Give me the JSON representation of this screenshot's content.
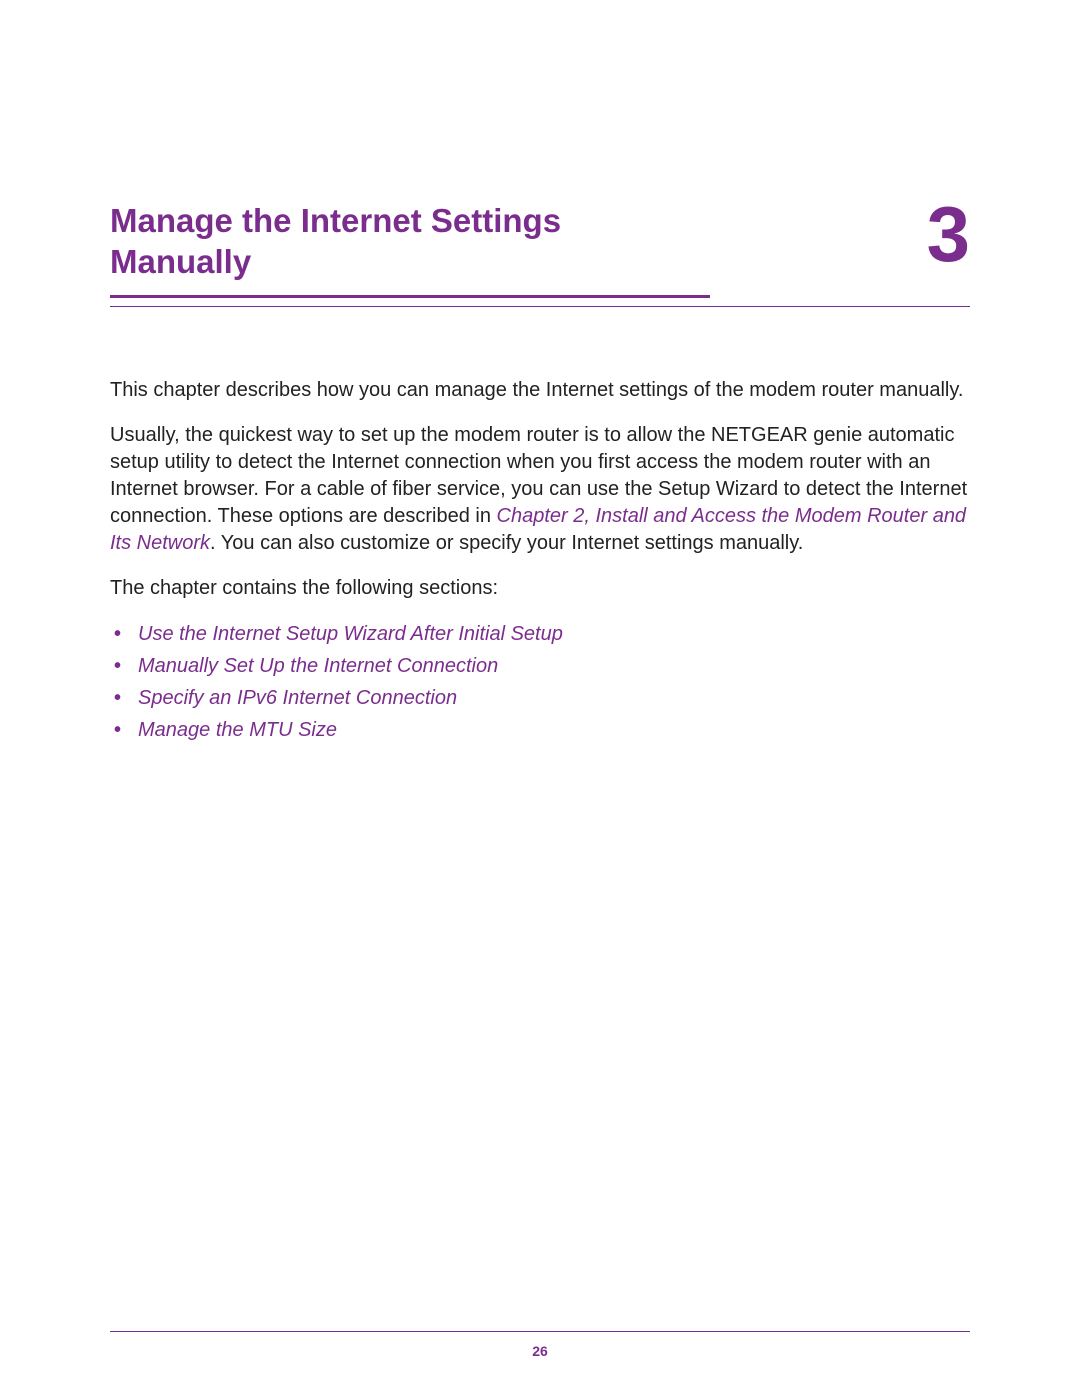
{
  "chapter": {
    "title": "Manage the Internet Settings Manually",
    "number": "3"
  },
  "paragraphs": {
    "intro": "This chapter describes how you can manage the Internet settings of the modem router manually.",
    "p2_part1": "Usually, the quickest way to set up the modem router is to allow the NETGEAR genie automatic setup utility to detect the Internet connection when you first access the modem router with an Internet browser. For a cable of fiber service, you can use the Setup Wizard to detect the Internet connection. These options are described in ",
    "p2_link": "Chapter 2, Install and Access the Modem Router and Its Network",
    "p2_part2": ". You can also customize or specify your Internet settings manually.",
    "p3": "The chapter contains the following sections:"
  },
  "sections": [
    "Use the Internet Setup Wizard After Initial Setup",
    "Manually Set Up the Internet Connection",
    "Specify an IPv6 Internet Connection",
    "Manage the MTU Size"
  ],
  "page_number": "26"
}
